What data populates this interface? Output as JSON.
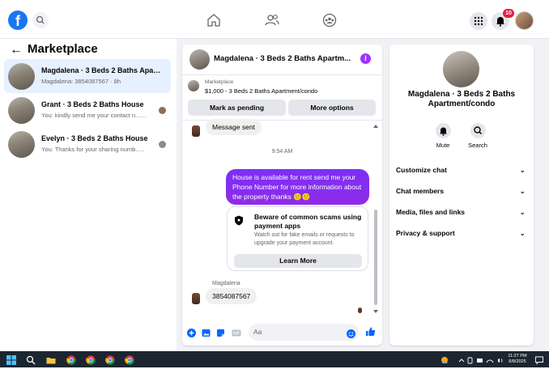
{
  "topbar": {
    "logo": "f",
    "notification_count": "10",
    "icons": [
      "facebook-logo",
      "search-icon",
      "home-icon",
      "friends-icon",
      "groups-icon",
      "menu-grid-icon",
      "bell-icon",
      "profile-avatar"
    ]
  },
  "left": {
    "title": "Marketplace",
    "conversations": [
      {
        "name": "Magdalena · 3 Beds 2 Baths Apart...",
        "preview": "Magdalena: 3854087567 · 8h",
        "active": true
      },
      {
        "name": "Grant · 3 Beds 2 Baths House",
        "preview": "You: kindly send me your contact n... · 1w",
        "active": false
      },
      {
        "name": "Evelyn · 3 Beds 2 Baths House",
        "preview": "You: Thanks for your sharing numb... · 2w",
        "active": false
      }
    ]
  },
  "chat": {
    "header_name": "Magdalena · 3 Beds 2 Baths Apartm...",
    "listing_label": "Marketplace",
    "listing_desc": "$1,000 - 3 Beds 2 Baths Apartment/condo",
    "mark_pending": "Mark as pending",
    "more_options": "More options",
    "messages": {
      "prev_in": "Message sent",
      "timestamp": "9:54 AM",
      "out": "House is available for rent send me your Phone Number for more information about the property thanks 🙂🙂",
      "scam_title": "Beware of common scams using payment apps",
      "scam_sub": "Watch out for fake emails or requests to upgrade your payment account.",
      "learn_more": "Learn More",
      "sender": "Magdalena",
      "reply": "3854087567"
    },
    "composer_placeholder": "Aa"
  },
  "right": {
    "title": "Magdalena · 3 Beds 2 Baths Apartment/condo",
    "mute": "Mute",
    "search": "Search",
    "sections": [
      "Customize chat",
      "Chat members",
      "Media, files and links",
      "Privacy & support"
    ]
  },
  "taskbar": {
    "time": "11:27 PM",
    "date": "8/8/2025"
  },
  "colors": {
    "brand": "#1877f2",
    "outgoing_bubble": "#8a2be2",
    "badge": "#e41e3f"
  }
}
